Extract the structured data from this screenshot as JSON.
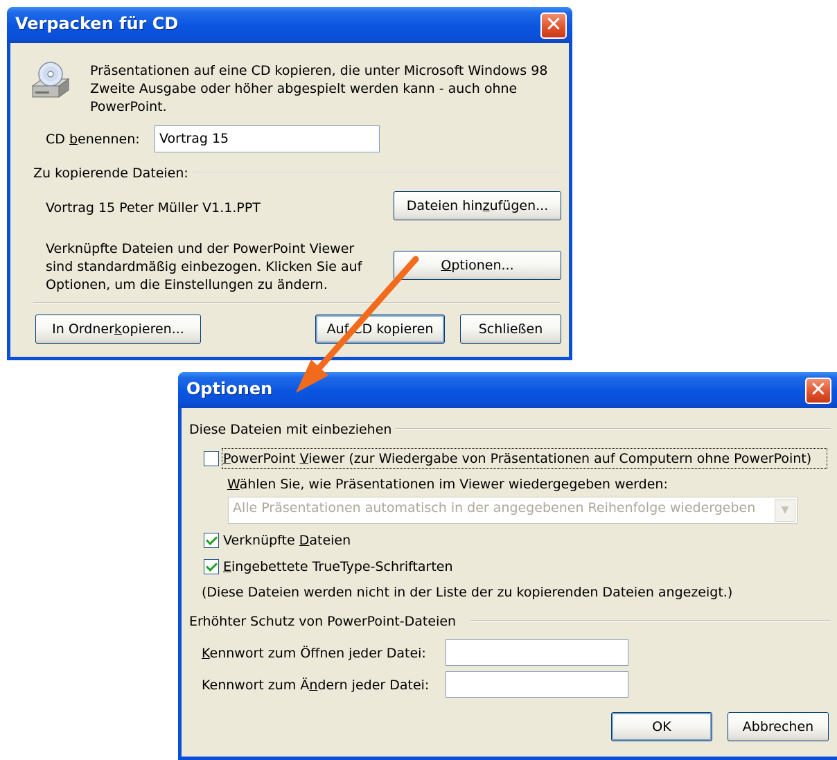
{
  "pack_dialog": {
    "title": "Verpacken für CD",
    "close_label": "✕",
    "description_lines": [
      "Präsentationen auf eine CD kopieren, die unter Microsoft Windows 98",
      "Zweite Ausgabe oder höher abgespielt werden kann - auch ohne",
      "PowerPoint."
    ],
    "cd_name_label_a": "CD ",
    "cd_name_label_u": "b",
    "cd_name_label_b": "enennen:",
    "cd_name_value": "Vortrag 15",
    "files_group_label": "Zu kopierende Dateien:",
    "file_name": "Vortrag 15 Peter Müller V1.1.PPT",
    "add_files_a": "Dateien hin",
    "add_files_u": "z",
    "add_files_b": "ufügen...",
    "linked_info_lines": [
      "Verknüpfte Dateien und der PowerPoint Viewer",
      "sind standardmäßig einbezogen. Klicken Sie auf",
      "Optionen, um die Einstellungen zu ändern."
    ],
    "options_u": "O",
    "options_b": "ptionen...",
    "copy_folder_a": "In Ordner ",
    "copy_folder_u": "k",
    "copy_folder_b": "opieren...",
    "copy_cd_label": "Auf CD kopieren",
    "close_button_label": "Schließen"
  },
  "options_dialog": {
    "title": "Optionen",
    "close_label": "✕",
    "include_group_label": "Diese Dateien mit einbeziehen",
    "viewer_checkbox": {
      "checked": false,
      "label_u": "P",
      "label_a": "owerPoint ",
      "label_u2": "V",
      "label_b": "iewer (zur Wiedergabe von Präsentationen auf Computern ohne PowerPoint)"
    },
    "select_label_u": "W",
    "select_label_b": "ählen Sie, wie Präsentationen im Viewer wiedergegeben werden:",
    "playback_select_value": "Alle Präsentationen automatisch in der angegebenen Reihenfolge wiedergeben",
    "linked_files_checkbox": {
      "checked": true,
      "label_a": "Verknüpfte ",
      "label_u": "D",
      "label_b": "ateien"
    },
    "embedded_fonts_checkbox": {
      "checked": true,
      "label_u": "E",
      "label_b": "ingebettete TrueType-Schriftarten"
    },
    "note": "(Diese Dateien werden nicht in der Liste der zu kopierenden Dateien angezeigt.)",
    "security_group_label": "Erhöhter Schutz von PowerPoint-Dateien",
    "open_password_label_u": "K",
    "open_password_label_b": "ennwort zum Öffnen jeder Datei:",
    "open_password_value": "",
    "modify_password_label_a": "Kennwort zum Ä",
    "modify_password_label_u": "n",
    "modify_password_label_b": "dern jeder Datei:",
    "modify_password_value": "",
    "ok_label": "OK",
    "cancel_label": "Abbrechen"
  },
  "annotation": {
    "arrow_color": "#f26b1d"
  },
  "colors": {
    "titlebar": "#0a4fd8",
    "client": "#ece9d8",
    "close": "#e0502a"
  }
}
